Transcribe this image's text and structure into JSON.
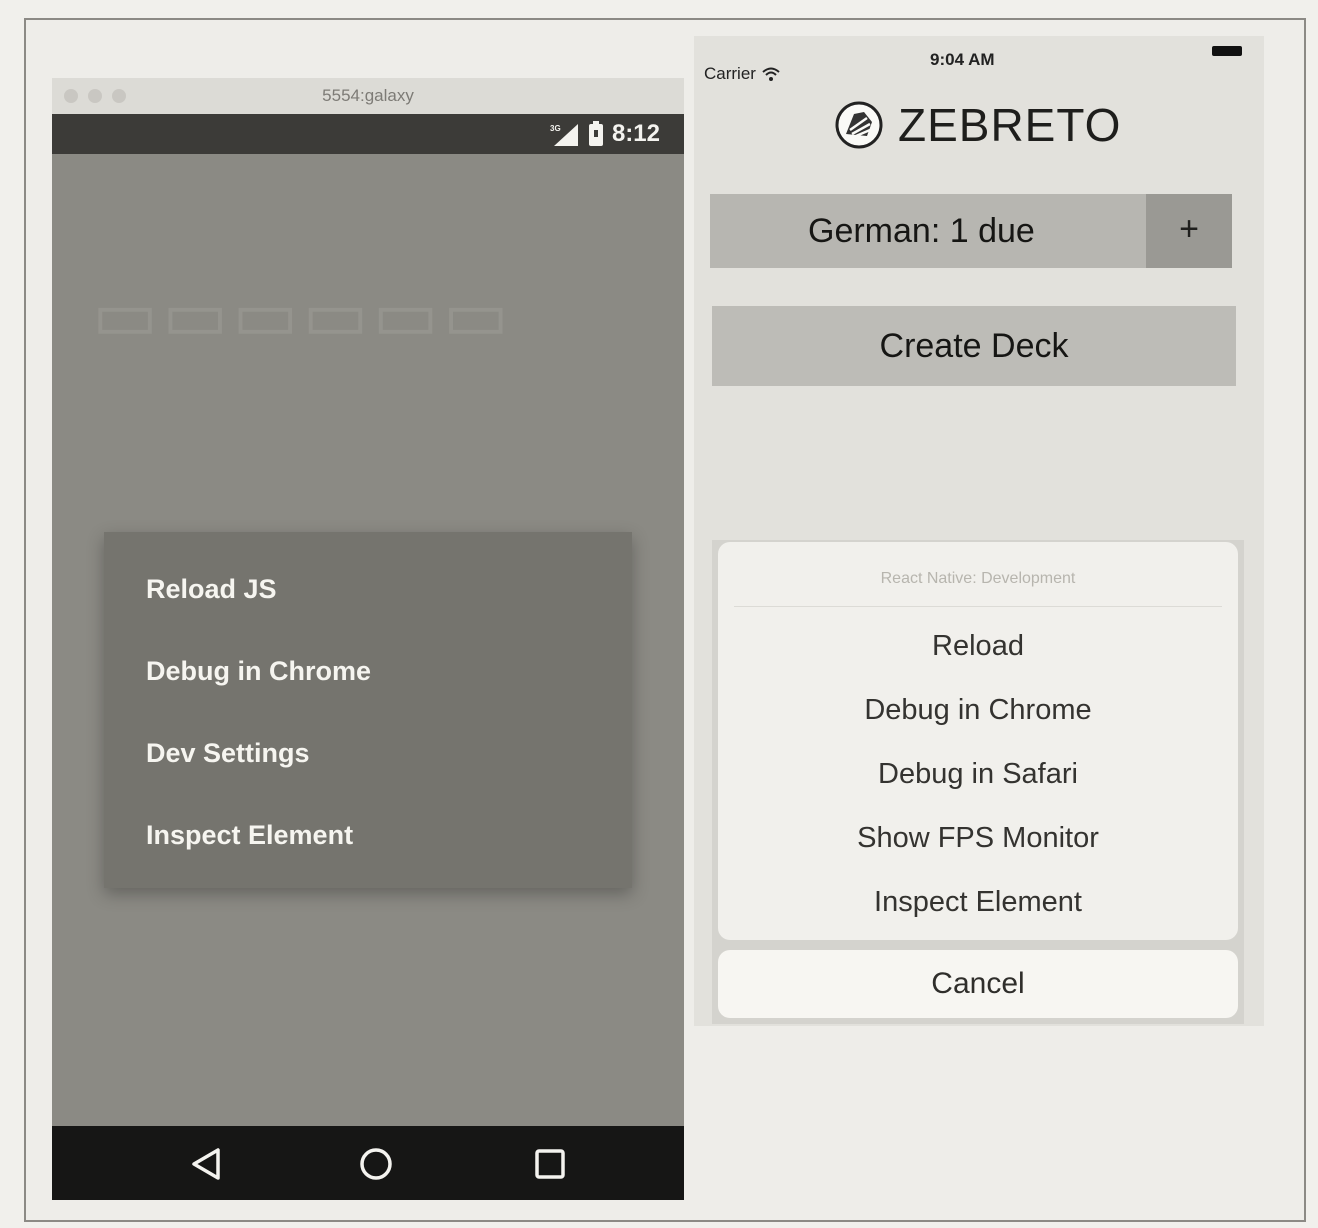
{
  "android": {
    "window_title": "5554:galaxy",
    "status": {
      "network": "3G",
      "time": "8:12"
    },
    "dev_menu": {
      "items": [
        "Reload JS",
        "Debug in Chrome",
        "Dev Settings",
        "Inspect Element"
      ]
    },
    "nav": {
      "back_icon": "back-triangle-icon",
      "home_icon": "home-circle-icon",
      "recents_icon": "recents-square-icon"
    }
  },
  "ios": {
    "status": {
      "carrier": "Carrier",
      "time": "9:04 AM"
    },
    "app_title": "ZEBRETO",
    "deck": {
      "label": "German: 1 due",
      "add_label": "+"
    },
    "create_deck_label": "Create Deck",
    "action_sheet": {
      "title": "React Native: Development",
      "items": [
        "Reload",
        "Debug in Chrome",
        "Debug in Safari",
        "Show FPS Monitor",
        "Inspect Element"
      ],
      "cancel_label": "Cancel"
    }
  }
}
